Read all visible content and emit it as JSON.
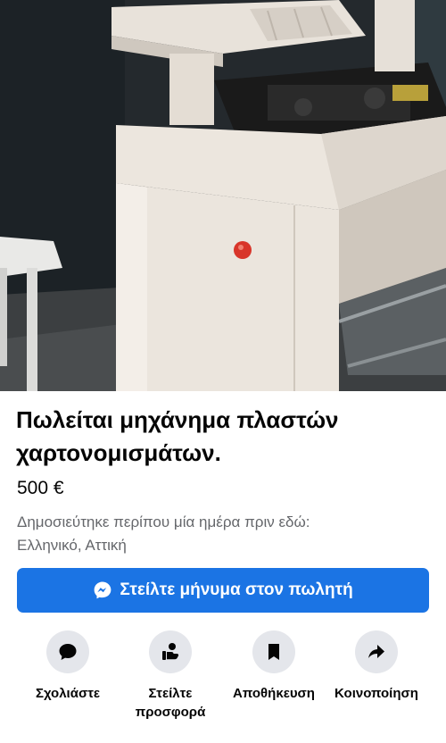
{
  "listing": {
    "title": "Πωλείται μηχάνημα πλαστών χαρτονομισμάτων.",
    "price": "500 €",
    "posted_line": "Δημοσιεύτηκε περίπου μία ημέρα πριν εδώ:",
    "location": "Ελληνικό, Αττική"
  },
  "message_button": {
    "label": "Στείλτε μήνυμα στον πωλητή",
    "icon": "messenger-icon",
    "color": "#1b74e4"
  },
  "actions": [
    {
      "label": "Σχολιάστε",
      "icon": "comment-icon"
    },
    {
      "label": "Στείλτε προσφορά",
      "icon": "offer-icon"
    },
    {
      "label": "Αποθήκευση",
      "icon": "bookmark-icon"
    },
    {
      "label": "Κοινοποίηση",
      "icon": "share-icon"
    }
  ]
}
